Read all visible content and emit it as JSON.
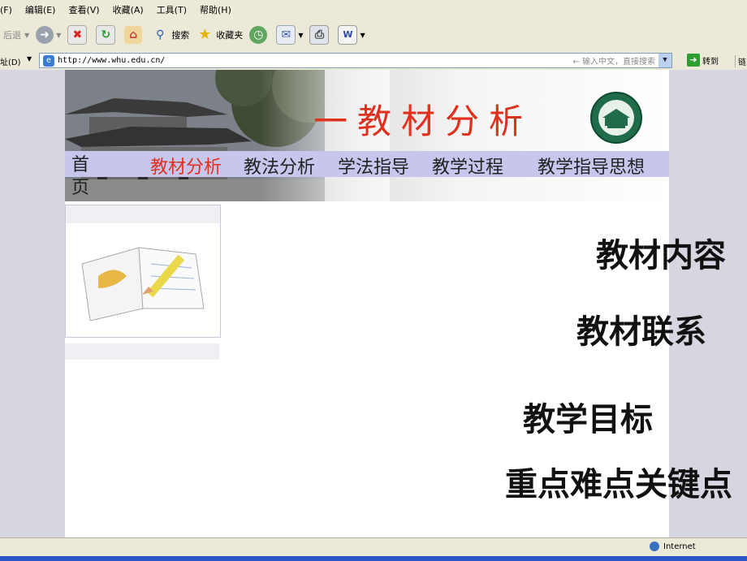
{
  "menu": {
    "file": "(F)",
    "edit": "编辑(E)",
    "view": "查看(V)",
    "favorites": "收藏(A)",
    "tools": "工具(T)",
    "help": "帮助(H)"
  },
  "toolbar": {
    "back": "后退",
    "search": "搜索",
    "favorites": "收藏夹"
  },
  "addressbar": {
    "label": "址(D)",
    "url": "http://www.whu.edu.cn/",
    "hint": "← 输入中文，直接搜索",
    "go": "转到",
    "links": "链"
  },
  "banner": {
    "title": "一教材分析"
  },
  "nav": {
    "home_1": "首",
    "home_2": "页",
    "items": [
      "教材分析",
      "教法分析",
      "学法指导",
      "教学过程",
      "教学指导思想"
    ]
  },
  "content": {
    "item1": "教材内容",
    "item2": "教材联系",
    "item3": "教学目标",
    "item4": "重点难点关键点"
  },
  "status": {
    "zone": "Internet"
  },
  "colors": {
    "title_red": "#e0301e",
    "nav_bg": "#c7c7ee",
    "active_nav": "#e0301e"
  }
}
